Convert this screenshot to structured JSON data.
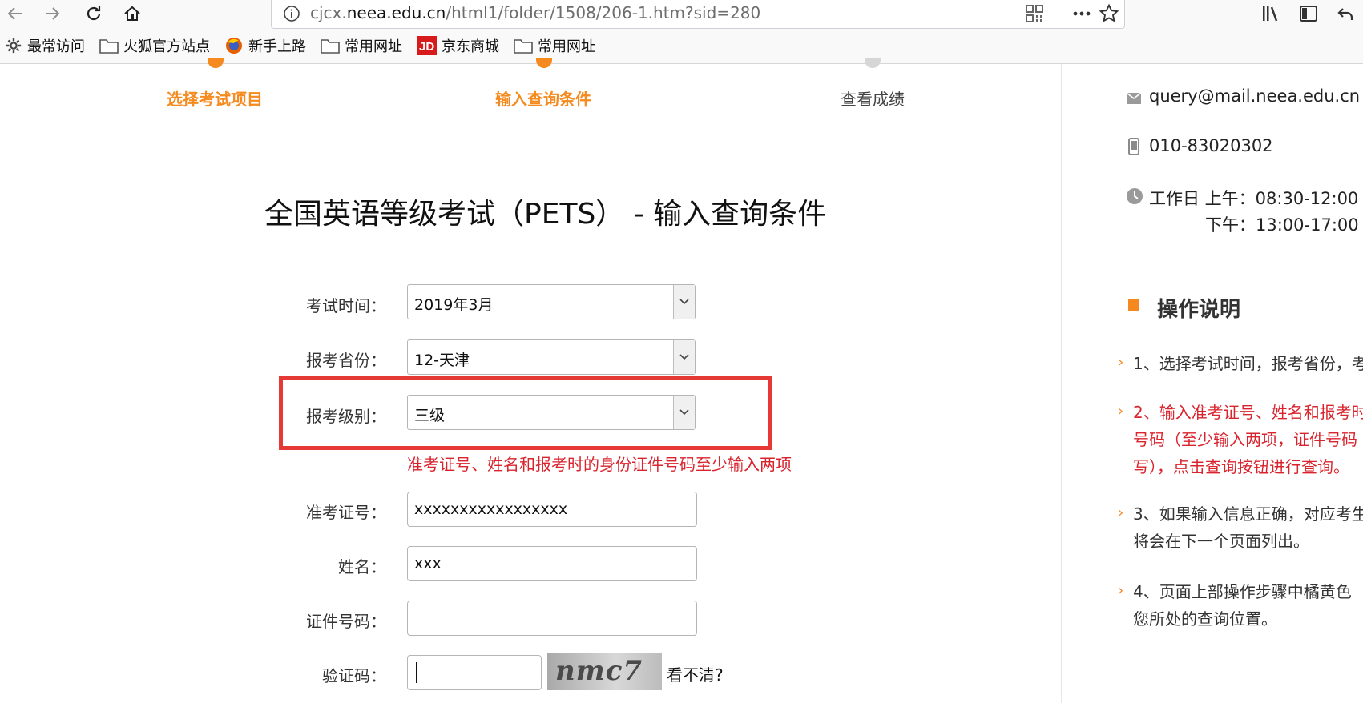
{
  "browser": {
    "url_prefix": "cjcx.",
    "url_domain": "neea.edu.cn",
    "url_path": "/html1/folder/1508/206-1.htm?sid=280",
    "bookmarks": [
      "最常访问",
      "火狐官方站点",
      "新手上路",
      "常用网址",
      "京东商城",
      "常用网址"
    ]
  },
  "steps": [
    "选择考试项目",
    "输入查询条件",
    "查看成绩"
  ],
  "form": {
    "title": "全国英语等级考试（PETS） - 输入查询条件",
    "exam_time_label": "考试时间：",
    "exam_time_value": "2019年3月",
    "province_label": "报考省份：",
    "province_value": "12-天津",
    "level_label": "报考级别：",
    "level_value": "三级",
    "hint": "准考证号、姓名和报考时的身份证件号码至少输入两项",
    "ticket_label": "准考证号：",
    "ticket_value": "xxxxxxxxxxxxxxxxx",
    "name_label": "姓名：",
    "name_value": "xxx",
    "id_label": "证件号码：",
    "id_value": "",
    "captcha_label": "验证码：",
    "captcha_value": "",
    "captcha_image_text": "nmc7",
    "refresh_label": "看不清?"
  },
  "sidebar": {
    "email": "query@mail.neea.edu.cn",
    "phone": "010-83020302",
    "hours_line1": "工作日 上午：08:30-12:00",
    "hours_line2": "下午：13:00-17:00",
    "section_title": "操作说明",
    "instructions": [
      "1、选择考试时间，报考省份，考",
      "2、输入准考证号、姓名和报考时",
      "号码（至少输入两项，证件号码",
      "写），点击查询按钮进行查询。",
      "3、如果输入信息正确，对应考生",
      "将会在下一个页面列出。",
      "4、页面上部操作步骤中橘黄色",
      "您所处的查询位置。"
    ]
  },
  "colors": {
    "accent_orange": "#f58a1f",
    "error_red": "#d9232d",
    "highlight_red": "#e53935"
  }
}
